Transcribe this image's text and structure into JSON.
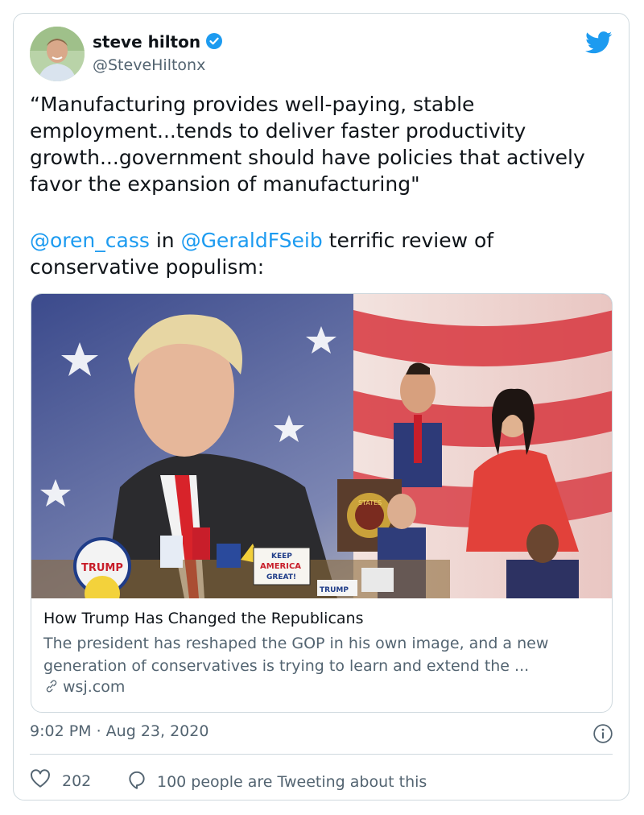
{
  "author": {
    "name": "steve hilton",
    "handle": "@SteveHiltonx"
  },
  "tweet": {
    "quote": "“Manufacturing provides well-paying, stable employment...tends to deliver faster productivity growth...government should have policies that actively favor the expansion of manufacturing\"",
    "mention1": "@oren_cass",
    "connector": " in ",
    "mention2": "@GeraldFSeib",
    "tail": " terrific review of conservative populism:"
  },
  "link_card": {
    "image_text": {
      "button_trump": "TRUMP",
      "sign_line1": "KEEP",
      "sign_line2": "AMERICA",
      "sign_line3": "GREAT!",
      "sign_trump": "TRUMP",
      "seal_text": "STATES"
    },
    "title": "How Trump Has Changed the Republicans",
    "description": "The president has reshaped the GOP in his own image, and a new generation of conservatives is trying to learn and extend the ...",
    "domain": "wsj.com"
  },
  "meta": {
    "timestamp": "9:02 PM · Aug 23, 2020"
  },
  "actions": {
    "likes": "202",
    "replies_text": "100 people are Tweeting about this"
  },
  "colors": {
    "accent": "#1d9bf0",
    "text": "#0f1419",
    "secondary": "#536471",
    "border": "#cfd9de"
  },
  "icons": [
    "verified-badge-icon",
    "twitter-bird-icon",
    "link-icon",
    "info-icon",
    "heart-icon",
    "reply-bubble-icon"
  ]
}
